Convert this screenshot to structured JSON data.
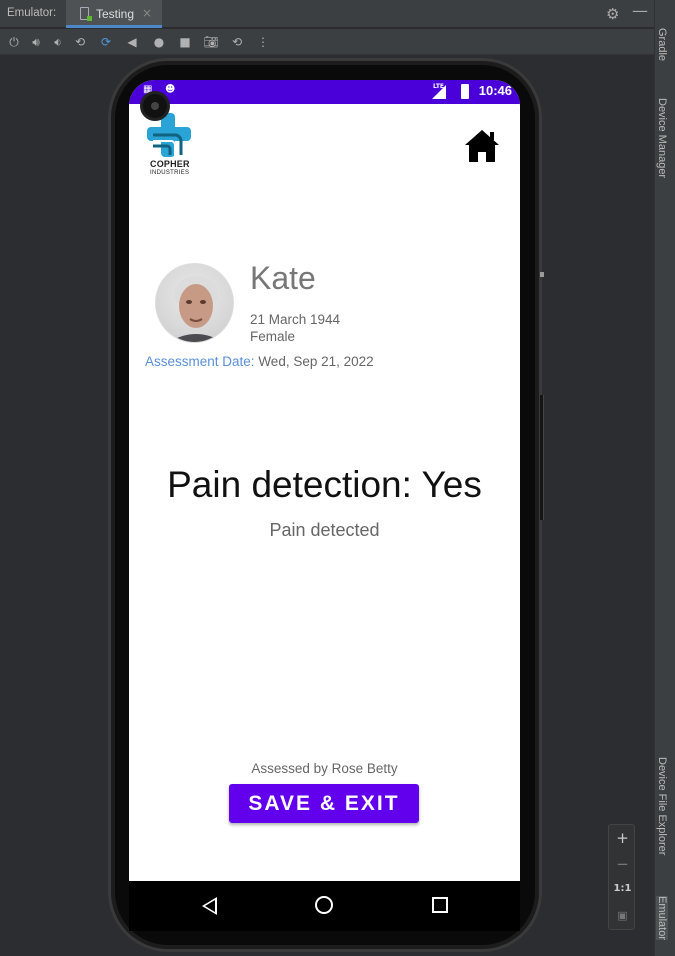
{
  "ide": {
    "panel_label": "Emulator:",
    "tab_label": "Testing",
    "tab_close": "×",
    "side_tabs": [
      "Gradle",
      "Device Manager",
      "Device File Explorer",
      "Emulator"
    ],
    "zoom": {
      "in": "+",
      "out": "−",
      "actual": "1:1"
    }
  },
  "status_bar": {
    "time": "10:46",
    "network": "LTE",
    "accent_color": "#4a00d9"
  },
  "app": {
    "logo": {
      "brand": "COPHER",
      "tagline": "INDUSTRIES"
    },
    "patient": {
      "name": "Kate",
      "dob": "21 March 1944",
      "gender": "Female"
    },
    "assessment": {
      "date_label": "Assessment Date:",
      "date_value": "Wed, Sep 21, 2022"
    },
    "result": {
      "headline": "Pain detection: Yes",
      "subtitle": "Pain detected"
    },
    "assessed_by": "Assessed by Rose Betty",
    "save_button": "SAVE & EXIT",
    "button_color": "#6200ee"
  }
}
